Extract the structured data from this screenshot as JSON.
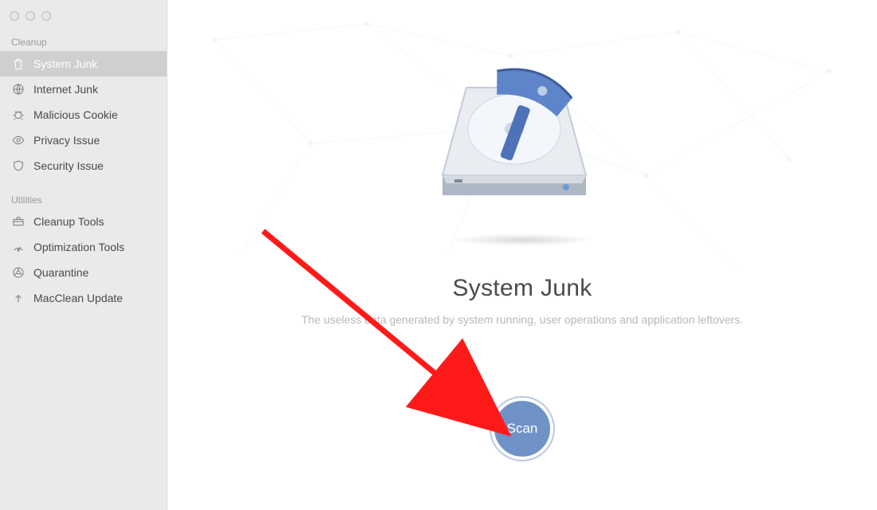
{
  "sidebar": {
    "sections": {
      "cleanup_label": "Cleanup",
      "utilities_label": "Utilities"
    },
    "items": {
      "system_junk": "System Junk",
      "internet_junk": "Internet Junk",
      "malicious_cookie": "Malicious Cookie",
      "privacy_issue": "Privacy Issue",
      "security_issue": "Security Issue",
      "cleanup_tools": "Cleanup Tools",
      "optimization_tools": "Optimization Tools",
      "quarantine": "Quarantine",
      "macclean_update": "MacClean Update"
    }
  },
  "main": {
    "title": "System Junk",
    "subtitle": "The useless data generated by system running, user operations and application leftovers.",
    "scan_label": "Scan"
  }
}
